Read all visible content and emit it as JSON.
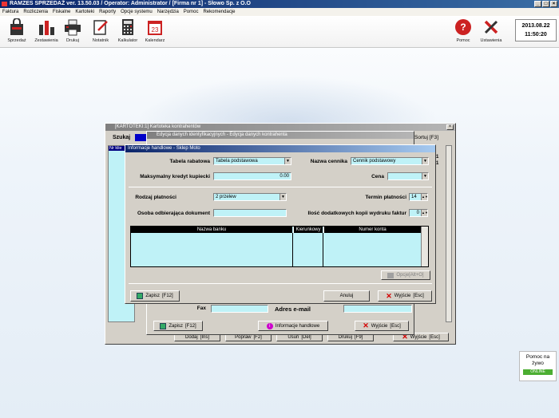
{
  "titlebar": {
    "title": "RAMZES SPRZEDAŻ ver. 13.50.03 /  Operator: Administrator /  [Firma nr 1] - Słowo Sp. z O.O"
  },
  "menu": [
    "Faktura",
    "Rozliczenia",
    "Fiskalne",
    "Kartoteki",
    "Raporty",
    "Opcje systemu",
    "Narzędzia",
    "Pomoc",
    "Rekomendacje"
  ],
  "toolbar": {
    "items": [
      {
        "label": "Sprzedaż",
        "icon": "shopping-bag-icon"
      },
      {
        "label": "Zestawienia",
        "icon": "bar-chart-icon"
      },
      {
        "label": "Drukuj",
        "icon": "printer-icon"
      },
      {
        "label": "Notatnik",
        "icon": "notepad-icon"
      },
      {
        "label": "Kalkulator",
        "icon": "calculator-icon"
      },
      {
        "label": "Kalendarz",
        "icon": "calendar-icon"
      }
    ],
    "calendar_day": "23",
    "help_label": "Pomoc",
    "settings_label": "Ustawienia",
    "date": "2013.08.22",
    "time": "11:50:20"
  },
  "kartoteka": {
    "title": "[KARTOTEKI:1] Kartoteka kontrahentów",
    "search": "Szukaj",
    "sort": "Sortuj",
    "sort_key": "[F3]",
    "col_nr": "Nr klie",
    "right_vals": [
      "11",
      "11"
    ],
    "buttons": {
      "dodaj": "Dodaj",
      "dodaj_key": "[Ins]",
      "popraw": "Popraw",
      "popraw_key": "[F2]",
      "usun": "Usuń",
      "usun_key": "[Del]",
      "drukuj": "Drukuj",
      "drukuj_key": "[F9]",
      "wyjscie": "Wyjście",
      "wyjscie_key": "[Esc]"
    }
  },
  "edycja": {
    "title": "Edycja danych identyfikacyjnych - Edycja danych kontrahenta",
    "fax": "Fax",
    "adres_email": "Adres e-mail",
    "zapisz": "Zapisz",
    "zapisz_key": "[F12]",
    "informacje": "Informacje handlowe",
    "wyjscie": "Wyjście",
    "wyjscie_key": "[Esc]"
  },
  "info": {
    "title": "Informacje handlowe - Sklep Moto",
    "tabela_rabatowa_label": "Tabela rabatowa",
    "tabela_rabatowa_value": "Tabela podstawowa",
    "nazwa_cennika_label": "Nazwa cennika",
    "nazwa_cennika_value": "Cennik podstawowy",
    "kredyt_label": "Maksymalny kredyt kupiecki",
    "kredyt_value": "0.00",
    "cena_label": "Cena",
    "cena_value": "",
    "rodzaj_platnosci_label": "Rodzaj płatności",
    "rodzaj_platnosci_value": "2 przelew",
    "termin_label": "Termin płatności",
    "termin_value": "14",
    "osoba_label": "Osoba odbierająca dokument",
    "osoba_value": "",
    "kopie_label": "Ilość dodatkowych kopii wydruku faktur",
    "kopie_value": "0",
    "grid_headers": [
      "Nazwa banku",
      "Kierunkowy",
      "Numer konta"
    ],
    "opcje": "Opcje[Alt+O]",
    "zapisz": "Zapisz",
    "zapisz_key": "[F12]",
    "anuluj": "Anuluj",
    "wyjscie": "Wyjście",
    "wyjscie_key": "[Esc]"
  },
  "help_widget": {
    "line1": "Pomoc na",
    "line2": "żywo",
    "status": "ONLINE"
  }
}
